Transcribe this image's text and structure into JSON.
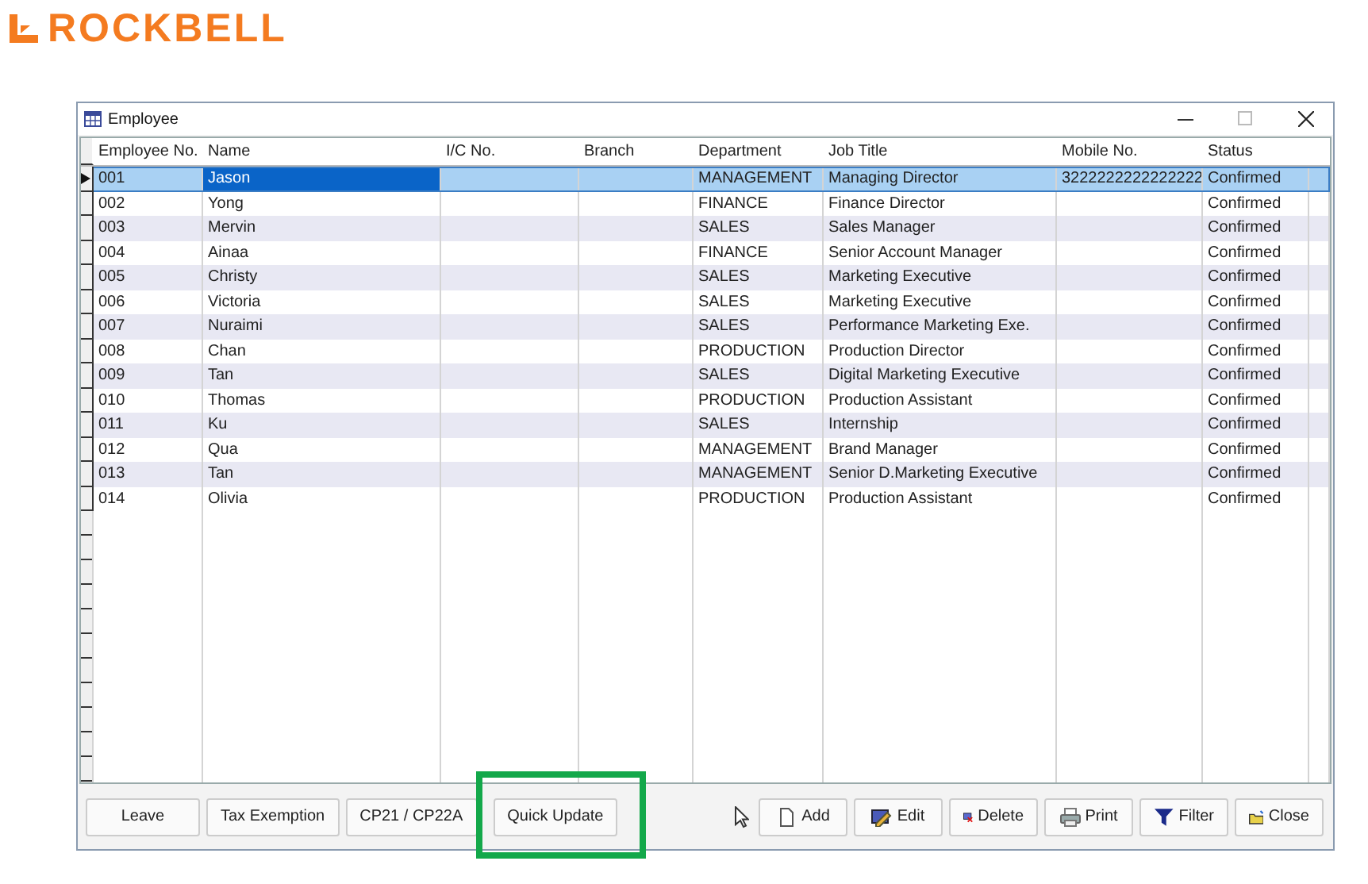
{
  "logo": {
    "text": "ROCKBELL"
  },
  "window": {
    "title": "Employee"
  },
  "table": {
    "columns": [
      {
        "label": "Employee No.",
        "focused": false
      },
      {
        "label": "Name",
        "focused": true
      },
      {
        "label": "I/C No.",
        "focused": false
      },
      {
        "label": "Branch",
        "focused": false
      },
      {
        "label": "Department",
        "focused": false
      },
      {
        "label": "Job Title",
        "focused": false
      },
      {
        "label": "Mobile No.",
        "focused": false
      },
      {
        "label": "Status",
        "focused": false
      }
    ],
    "rows": [
      {
        "selected": true,
        "cells": [
          "001",
          "Jason",
          "",
          "",
          "MANAGEMENT",
          "Managing Director",
          "3222222222222222",
          "Confirmed"
        ]
      },
      {
        "selected": false,
        "cells": [
          "002",
          "Yong",
          "",
          "",
          "FINANCE",
          "Finance Director",
          "",
          "Confirmed"
        ]
      },
      {
        "selected": false,
        "cells": [
          "003",
          "Mervin",
          "",
          "",
          "SALES",
          "Sales Manager",
          "",
          "Confirmed"
        ]
      },
      {
        "selected": false,
        "cells": [
          "004",
          "Ainaa",
          "",
          "",
          "FINANCE",
          "Senior Account Manager",
          "",
          "Confirmed"
        ]
      },
      {
        "selected": false,
        "cells": [
          "005",
          "Christy",
          "",
          "",
          "SALES",
          "Marketing Executive",
          "",
          "Confirmed"
        ]
      },
      {
        "selected": false,
        "cells": [
          "006",
          "Victoria",
          "",
          "",
          "SALES",
          "Marketing Executive",
          "",
          "Confirmed"
        ]
      },
      {
        "selected": false,
        "cells": [
          "007",
          "Nuraimi",
          "",
          "",
          "SALES",
          "Performance Marketing Exe.",
          "",
          "Confirmed"
        ]
      },
      {
        "selected": false,
        "cells": [
          "008",
          "Chan",
          "",
          "",
          "PRODUCTION",
          "Production Director",
          "",
          "Confirmed"
        ]
      },
      {
        "selected": false,
        "cells": [
          "009",
          "Tan",
          "",
          "",
          "SALES",
          "Digital Marketing Executive",
          "",
          "Confirmed"
        ]
      },
      {
        "selected": false,
        "cells": [
          "010",
          "Thomas",
          "",
          "",
          "PRODUCTION",
          "Production Assistant",
          "",
          "Confirmed"
        ]
      },
      {
        "selected": false,
        "cells": [
          "011",
          "Ku",
          "",
          "",
          "SALES",
          "Internship",
          "",
          "Confirmed"
        ]
      },
      {
        "selected": false,
        "cells": [
          "012",
          "Qua",
          "",
          "",
          "MANAGEMENT",
          "Brand Manager",
          "",
          "Confirmed"
        ]
      },
      {
        "selected": false,
        "cells": [
          "013",
          "Tan",
          "",
          "",
          "MANAGEMENT",
          "Senior D.Marketing Executive",
          "",
          "Confirmed"
        ]
      },
      {
        "selected": false,
        "cells": [
          "014",
          "Olivia",
          "",
          "",
          "PRODUCTION",
          "Production Assistant",
          "",
          "Confirmed"
        ]
      }
    ]
  },
  "left_buttons": [
    {
      "label": "Leave",
      "highlighted": false
    },
    {
      "label": "Tax Exemption",
      "highlighted": false
    },
    {
      "label": "CP21 / CP22A",
      "highlighted": false
    },
    {
      "label": "Quick Update",
      "highlighted": true
    }
  ],
  "right_buttons": [
    {
      "label": "Add",
      "kind": "add"
    },
    {
      "label": "Edit",
      "kind": "edit"
    },
    {
      "label": "Delete",
      "kind": "delete"
    },
    {
      "label": "Print",
      "kind": "print"
    },
    {
      "label": "Filter",
      "kind": "filter"
    },
    {
      "label": "Close",
      "kind": "close"
    }
  ]
}
